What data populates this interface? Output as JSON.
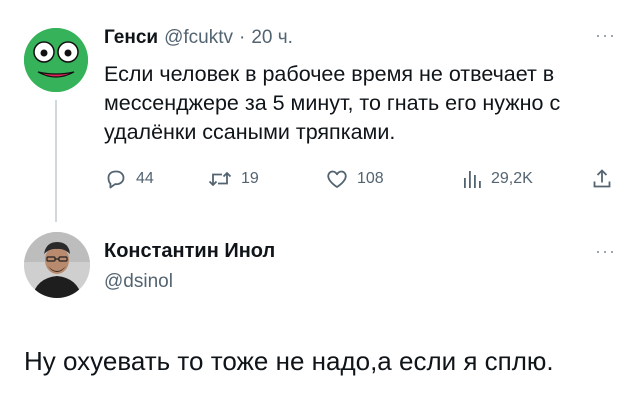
{
  "parent_tweet": {
    "author_name": "Генси",
    "author_handle": "@fcuktv",
    "separator": "·",
    "time": "20 ч.",
    "more": "···",
    "text": "Если человек в рабочее время не отвечает в мессенджере за 5 минут, то гнать его нужно с удалёнки ссаными тряпками.",
    "actions": {
      "replies": "44",
      "reposts": "19",
      "likes": "108",
      "views": "29,2K"
    },
    "icons": {
      "avatar": "green-frog-face-avatar",
      "reply": "speech-bubble-icon",
      "repost": "repost-arrows-icon",
      "like": "heart-icon",
      "views": "bar-chart-icon",
      "share": "share-upload-icon"
    }
  },
  "reply_tweet": {
    "author_name": "Константин Инол",
    "author_handle": "@dsinol",
    "more": "···",
    "text": "Ну охуевать то тоже не надо,а если я сплю.",
    "icons": {
      "avatar": "user-photo-avatar"
    }
  },
  "colors": {
    "text_primary": "#0f1419",
    "text_secondary": "#536471",
    "thread_line": "#cfd9de",
    "avatar_green": "#36b25a",
    "avatar_mouth": "#e2245a"
  }
}
